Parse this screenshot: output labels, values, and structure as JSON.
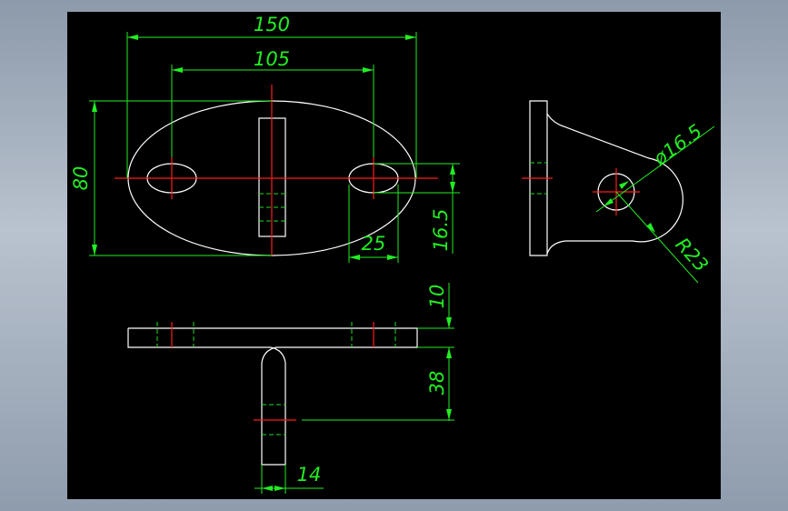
{
  "dimensions": {
    "overall_length": "150",
    "hole_spacing": "105",
    "overall_height": "80",
    "slot_width": "25",
    "hole_diameter_side": "16.5",
    "flange_thickness": "10",
    "stem_height": "38",
    "stem_width": "14",
    "eye_hole_diameter": "ø16.5",
    "eye_radius": "R23"
  },
  "colors": {
    "background": "#000000",
    "geometry": "#ffffff",
    "centerlines": "#ff1a1a",
    "dimensions": "#22ee22"
  }
}
